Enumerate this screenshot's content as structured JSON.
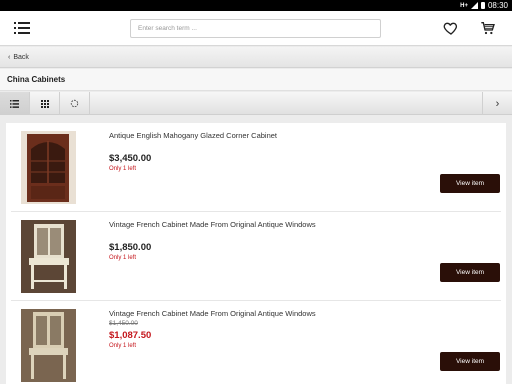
{
  "status_bar": {
    "network": "H+",
    "time": "08:30"
  },
  "header": {
    "search_placeholder": "Enter search term ..."
  },
  "nav": {
    "back_label": "Back"
  },
  "category": {
    "title": "China Cabinets"
  },
  "products": [
    {
      "name": "Antique English Mahogany Glazed Corner Cabinet",
      "price": "$3,450.00",
      "old_price": "",
      "stock": "Only 1 left",
      "button": "View item"
    },
    {
      "name": "Vintage French Cabinet Made From Original Antique Windows",
      "price": "$1,850.00",
      "old_price": "",
      "stock": "Only 1 left",
      "button": "View item"
    },
    {
      "name": "Vintage French Cabinet Made From Original Antique Windows",
      "price": "$1,087.50",
      "old_price": "$1,450.00",
      "stock": "Only 1 left",
      "button": "View item"
    }
  ],
  "colors": {
    "accent_button": "#2a0f08",
    "sale_red": "#c4161c"
  }
}
